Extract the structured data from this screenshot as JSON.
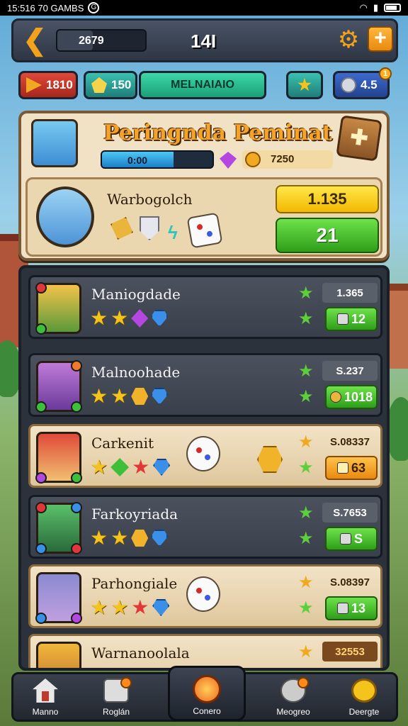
{
  "status_bar": {
    "time_text": "15:516 70 GAMBS",
    "app_glyph": "G"
  },
  "top_bar": {
    "progress_value": "2679",
    "title": "14I"
  },
  "resources": {
    "red": "1810",
    "teal": "150",
    "center_label": "MELNAIAIO",
    "blue": "4.5",
    "blue_badge": "1"
  },
  "hero_panel": {
    "title": "Peringnda Peminat",
    "bar_value": "0:00",
    "coin_value": "7250",
    "card_name": "Warbogolch",
    "value_button": "1.135",
    "go_button": "21"
  },
  "list_rows": [
    {
      "name": "Maniogdade",
      "price": "1.365",
      "button": "12",
      "style": "dark"
    },
    {
      "name": "Malnoohade",
      "price": "S.237",
      "button": "1018",
      "style": "dark"
    },
    {
      "name": "Carkenit",
      "price": "S.08337",
      "button": "63",
      "style": "light"
    },
    {
      "name": "Farkoyriada",
      "price": "S.7653",
      "button": "S",
      "style": "dark"
    },
    {
      "name": "Parhongiale",
      "price": "S.08397",
      "button": "13",
      "style": "light"
    },
    {
      "name": "Warnanoolala",
      "price": "32553",
      "button": "",
      "style": "light"
    }
  ],
  "nav": {
    "home": "Manno",
    "shop": "Roglán",
    "center": "Conero",
    "dial": "Meogreo",
    "medal": "Deergte"
  },
  "colors": {
    "accent": "#f3a21c",
    "panel": "#2c323c",
    "green": "#3e9e1a"
  }
}
